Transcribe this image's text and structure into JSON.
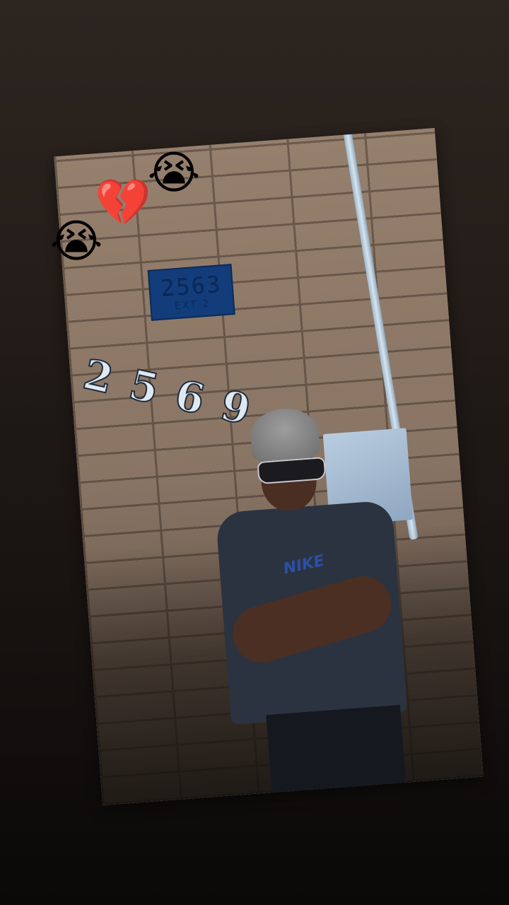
{
  "photo": {
    "sign_number": "2563",
    "sign_sub": "EXT 2",
    "wall_number": "2569",
    "shirt_logo": "NIKE"
  },
  "stickers": {
    "crying_face_top": "😭",
    "broken_heart": "💔",
    "crying_face_left": "😭"
  }
}
